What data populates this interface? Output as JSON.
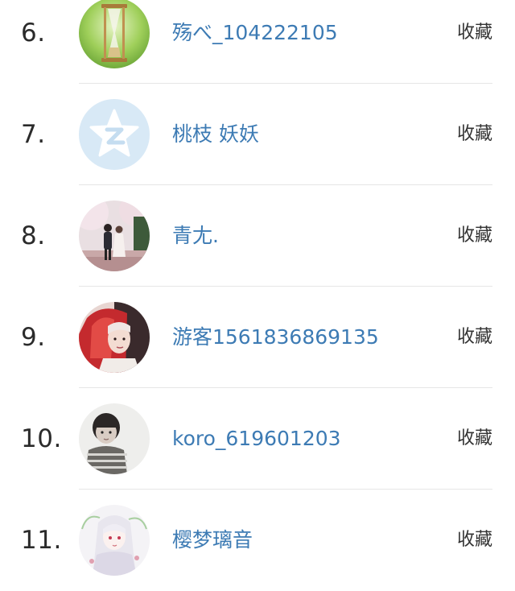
{
  "list": {
    "items": [
      {
        "rank": "6.",
        "name": "殇べ_104222105",
        "action": "收藏",
        "avatar": "hourglass-avatar"
      },
      {
        "rank": "7.",
        "name": "桃枝 妖妖",
        "action": "收藏",
        "avatar": "default-qzone-avatar"
      },
      {
        "rank": "8.",
        "name": "青尢.",
        "action": "收藏",
        "avatar": "couple-cherry-blossom-avatar"
      },
      {
        "rank": "9.",
        "name": "游客1561836869135",
        "action": "收藏",
        "avatar": "red-haired-portrait-avatar"
      },
      {
        "rank": "10.",
        "name": "koro_619601203",
        "action": "收藏",
        "avatar": "child-photo-avatar"
      },
      {
        "rank": "11.",
        "name": "樱梦璃音",
        "action": "收藏",
        "avatar": "anime-girl-avatar"
      }
    ]
  },
  "colors": {
    "username": "#3d7bb4",
    "rank": "#2b2b2b",
    "divider": "#e6e6e6"
  }
}
